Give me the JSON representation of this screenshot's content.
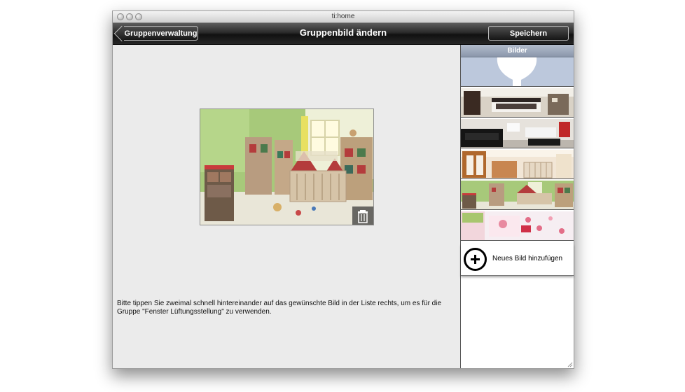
{
  "window": {
    "title": "ti:home"
  },
  "toolbar": {
    "back_label": "Gruppenverwaltung",
    "title": "Gruppenbild ändern",
    "save_label": "Speichern"
  },
  "main": {
    "instruction": "Bitte tippen Sie zweimal schnell hintereinander auf das gewünschte Bild in der Liste rechts, um es für die Gruppe \"Fenster Lüftungsstellung\" zu verwenden."
  },
  "sidebar": {
    "header": "Bilder",
    "add_label": "Neues Bild hinzufügen"
  }
}
